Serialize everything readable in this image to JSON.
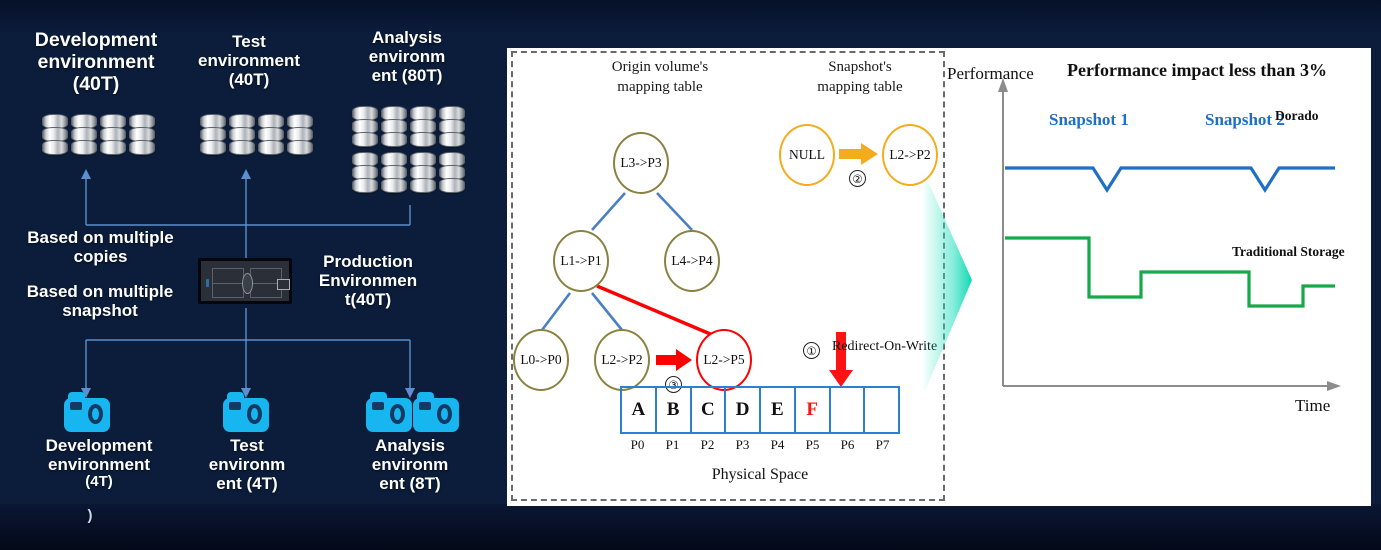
{
  "left_panel": {
    "top_labels": [
      {
        "text": "Development\nenvironment\n(40T)"
      },
      {
        "text": "Test\nenvironment\n(40T)"
      },
      {
        "text": "Analysis\nenvironm\nent (80T)"
      }
    ],
    "dev_top_label": "Development environment (40T)",
    "test_top_label": "Test environment (40T)",
    "analysis_top_label": "Analysis environm ent (80T)",
    "based_copies": "Based on multiple copies",
    "based_snapshot": "Based on multiple snapshot",
    "production_label": "Production Environmen t(40T)",
    "bottom_labels": [
      {
        "line1": "Development",
        "line2": "environment",
        "line3": "(4T)"
      },
      {
        "line1": "Test",
        "line2": "environm",
        "line3": "ent (4T)"
      },
      {
        "line1": "Analysis",
        "line2": "environm",
        "line3": "ent (8T)"
      }
    ],
    "stray_paren": ")",
    "disk_counts": {
      "development": 4,
      "test": 4,
      "analysis_row1": 4,
      "analysis_row2": 4
    },
    "camera_counts": {
      "development": 1,
      "test": 1,
      "analysis": 2
    },
    "accent_cyan": "#18b6f0",
    "connector_color": "#5b8fd0"
  },
  "center_panel": {
    "origin_caption_line1": "Origin volume's",
    "origin_caption_line2": "mapping table",
    "snapshot_caption_line1": "Snapshot's",
    "snapshot_caption_line2": "mapping table",
    "tree_nodes": {
      "root": "L3->P3",
      "left": "L1->P1",
      "right": "L4->P4",
      "leaf1": "L0->P0",
      "leaf2": "L2->P2",
      "leaf_new": "L2->P5"
    },
    "snapshot_nodes": {
      "before": "NULL",
      "after": "L2->P2"
    },
    "steps": {
      "one": "①",
      "two": "②",
      "three": "③"
    },
    "redirect_label": "Redirect-On-Write",
    "physical_space_label": "Physical Space",
    "blocks": [
      {
        "value": "A",
        "tag": "P0",
        "red": false
      },
      {
        "value": "B",
        "tag": "P1",
        "red": false
      },
      {
        "value": "C",
        "tag": "P2",
        "red": false
      },
      {
        "value": "D",
        "tag": "P3",
        "red": false
      },
      {
        "value": "E",
        "tag": "P4",
        "red": false
      },
      {
        "value": "F",
        "tag": "P5",
        "red": true
      },
      {
        "value": "",
        "tag": "P6",
        "red": false
      },
      {
        "value": "",
        "tag": "P7",
        "red": false
      }
    ],
    "colors": {
      "node_border": "#8a8242",
      "node_border_yellow": "#f5ac1c",
      "node_border_red": "#ff0000",
      "edge_blue": "#4a7fc1",
      "edge_red": "#ff0000",
      "block_border": "#2d7fd1"
    }
  },
  "chart_data": {
    "type": "line",
    "title": "Performance impact less than 3%",
    "xlabel": "Time",
    "ylabel": "Performance",
    "annotations": [
      "Snapshot 1",
      "Snapshot 2"
    ],
    "legend": [
      "Dorado",
      "Traditional Storage"
    ],
    "legend_position": "inline-right",
    "grid": false,
    "xlim": [
      0,
      100
    ],
    "ylim": [
      0,
      100
    ],
    "series": [
      {
        "name": "Dorado",
        "color": "#1f6fc4",
        "x": [
          0,
          26,
          32,
          38,
          72,
          78,
          84,
          100
        ],
        "y": [
          78,
          78,
          64,
          78,
          78,
          64,
          78,
          78
        ]
      },
      {
        "name": "Traditional Storage",
        "color": "#16a84a",
        "x": [
          0,
          26,
          26,
          46,
          46,
          72,
          72,
          86,
          86,
          100
        ],
        "y": [
          44,
          44,
          26,
          26,
          40,
          40,
          22,
          22,
          33,
          33
        ]
      }
    ],
    "snapshot_events_x": [
      32,
      78
    ]
  }
}
